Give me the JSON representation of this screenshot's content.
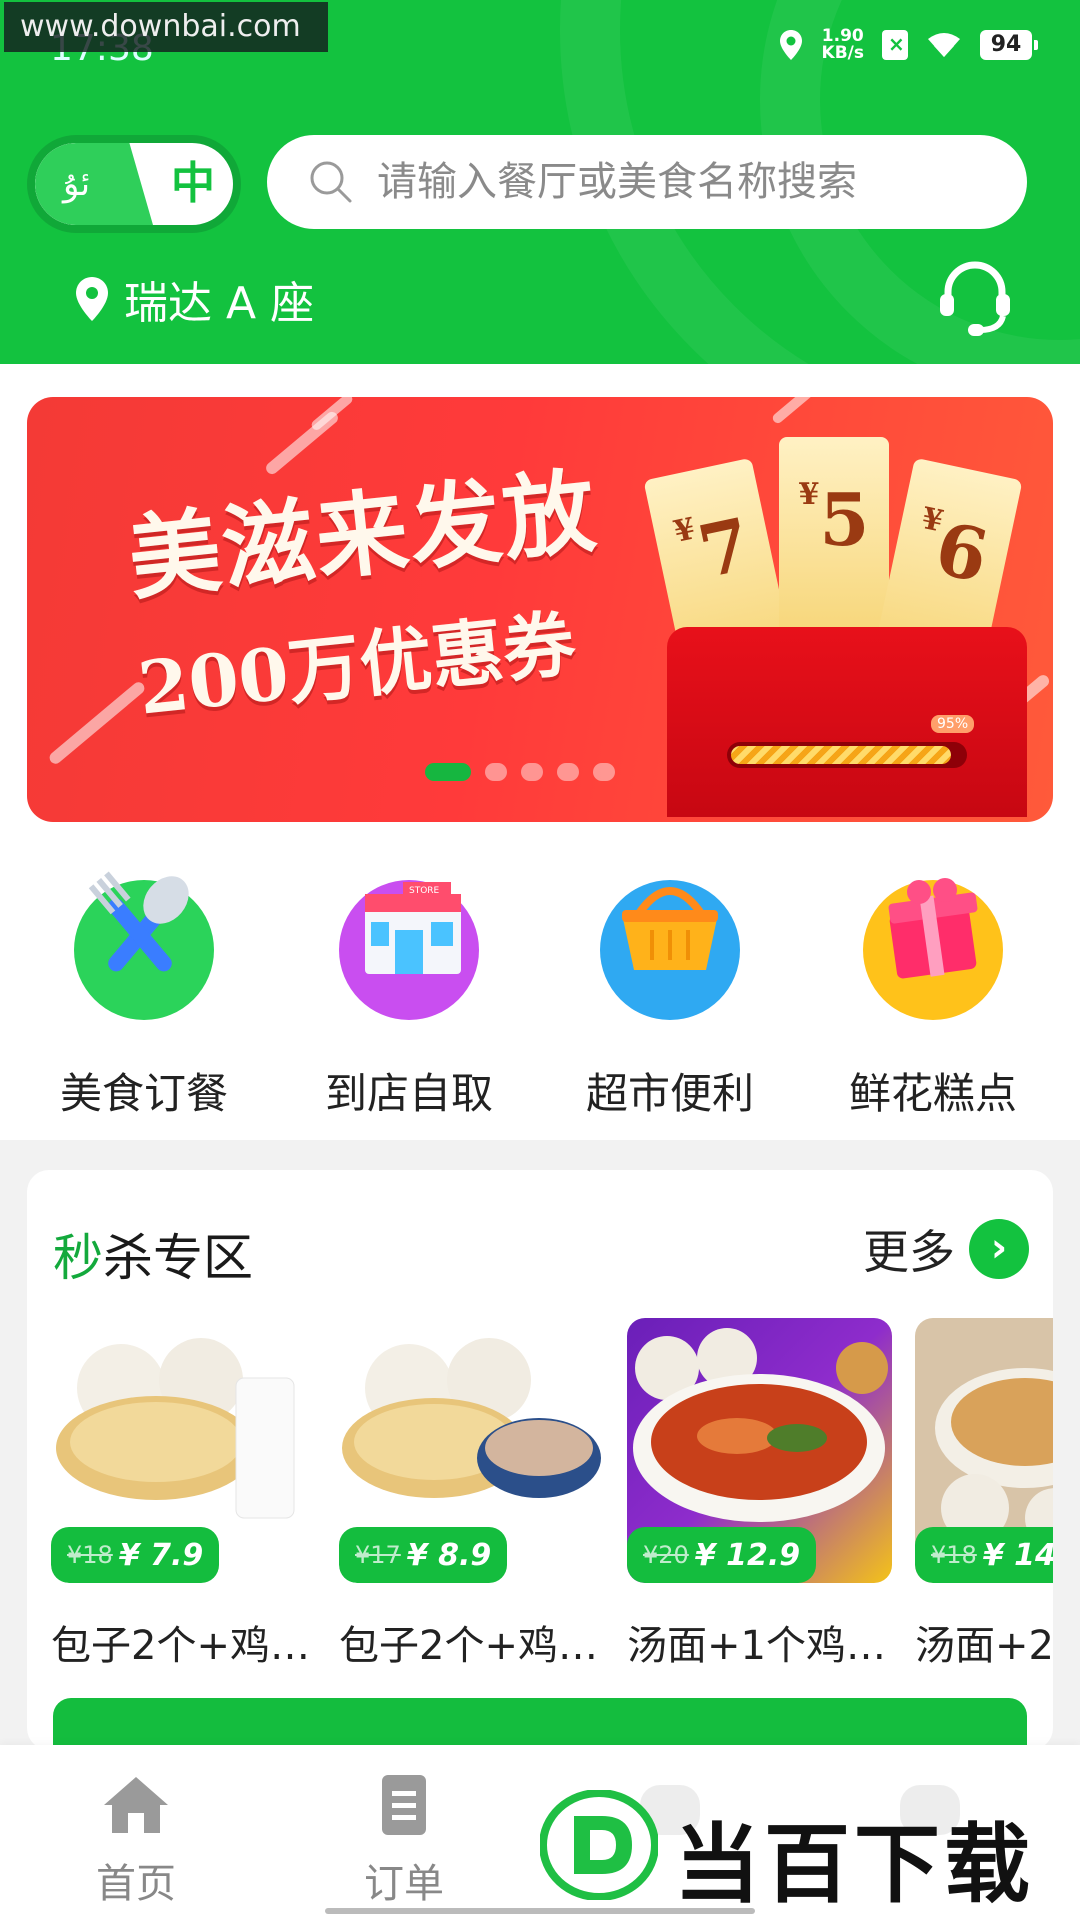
{
  "status_bar": {
    "watermark": "www.downbai.com",
    "time": "17:38",
    "net_speed_value": "1.90",
    "net_speed_unit": "KB/s",
    "battery": "94"
  },
  "header": {
    "lang_uyghur": "ئۇ",
    "lang_chinese": "中",
    "search_placeholder": "请输入餐厅或美食名称搜索",
    "location": "瑞达 A 座"
  },
  "banner": {
    "title": "美滋来发放",
    "subtitle": "200万优惠券",
    "coupons": [
      {
        "currency": "¥",
        "amount": "7"
      },
      {
        "currency": "¥",
        "amount": "5"
      },
      {
        "currency": "¥",
        "amount": "6"
      }
    ],
    "progress_label": "95%",
    "progress": 0.95,
    "slide_count": 5,
    "active_slide": 1
  },
  "categories": [
    {
      "label": "美食订餐",
      "icon": "utensils-icon",
      "color": "#2bd35a"
    },
    {
      "label": "到店自取",
      "icon": "store-icon",
      "color": "#c94ef0"
    },
    {
      "label": "超市便利",
      "icon": "basket-icon",
      "color": "#2fa9f2"
    },
    {
      "label": "鲜花糕点",
      "icon": "gift-icon",
      "color": "#ffc21a"
    }
  ],
  "flash_sale": {
    "title_first": "秒",
    "title_rest": "杀专区",
    "more_label": "更多",
    "products": [
      {
        "name": "包子2个+鸡…",
        "old_price": "¥18",
        "new_price": "¥ 7.9"
      },
      {
        "name": "包子2个+鸡…",
        "old_price": "¥17",
        "new_price": "¥ 8.9"
      },
      {
        "name": "汤面+1个鸡…",
        "old_price": "¥20",
        "new_price": "¥ 12.9"
      },
      {
        "name": "汤面+2",
        "old_price": "¥18",
        "new_price": "¥ 14"
      }
    ]
  },
  "bottom_nav": {
    "items": [
      {
        "label": "首页"
      },
      {
        "label": "订单"
      }
    ],
    "brand_text": "当百下载"
  },
  "colors": {
    "brand_green": "#13c23f",
    "banner_red": "#f43a36"
  }
}
